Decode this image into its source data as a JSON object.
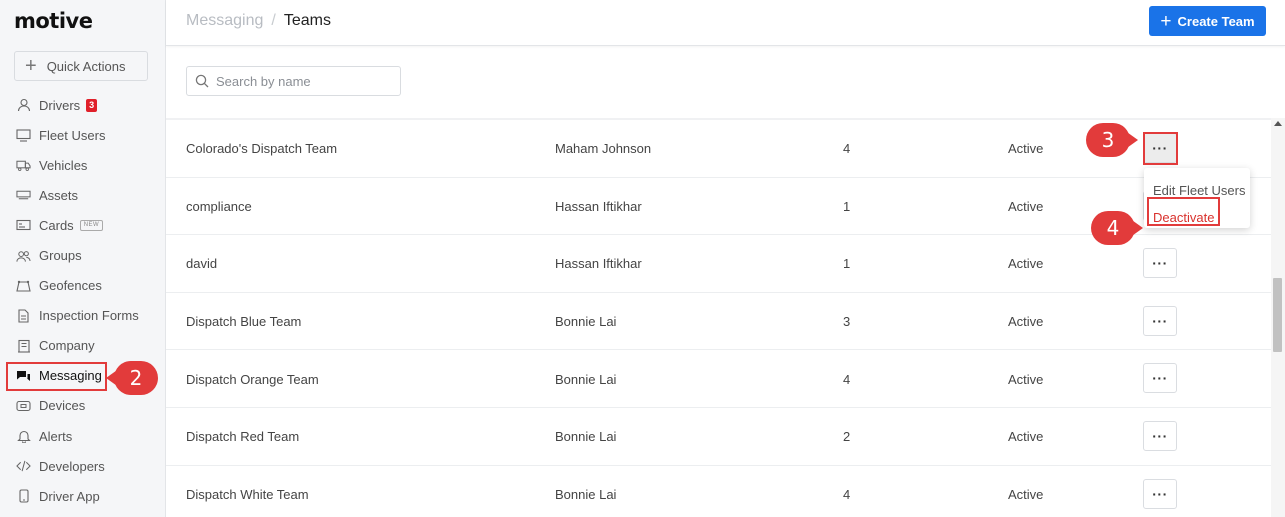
{
  "brand": {
    "logo": "motive"
  },
  "sidebar": {
    "quick_actions": "Quick Actions",
    "items": [
      {
        "label": "Drivers",
        "icon": "person-icon",
        "badge": "3"
      },
      {
        "label": "Fleet Users",
        "icon": "monitor-icon"
      },
      {
        "label": "Vehicles",
        "icon": "truck-icon"
      },
      {
        "label": "Assets",
        "icon": "trailer-icon"
      },
      {
        "label": "Cards",
        "icon": "card-icon",
        "tag": "NEW"
      },
      {
        "label": "Groups",
        "icon": "group-icon"
      },
      {
        "label": "Geofences",
        "icon": "geofence-icon"
      },
      {
        "label": "Inspection Forms",
        "icon": "document-icon"
      },
      {
        "label": "Company",
        "icon": "building-icon"
      },
      {
        "label": "Messaging",
        "icon": "chat-icon",
        "active": true
      },
      {
        "label": "Devices",
        "icon": "device-icon"
      },
      {
        "label": "Alerts",
        "icon": "bell-icon"
      },
      {
        "label": "Developers",
        "icon": "code-icon"
      },
      {
        "label": "Driver App",
        "icon": "phone-icon"
      }
    ]
  },
  "header": {
    "breadcrumb_parent": "Messaging",
    "breadcrumb_sep": "/",
    "breadcrumb_current": "Teams",
    "create_button": "Create Team"
  },
  "search": {
    "placeholder": "Search by name"
  },
  "teams": [
    {
      "name": "Colorado's Dispatch Team",
      "owner": "Maham Johnson",
      "count": "4",
      "status": "Active"
    },
    {
      "name": "compliance",
      "owner": "Hassan Iftikhar",
      "count": "1",
      "status": "Active"
    },
    {
      "name": "david",
      "owner": "Hassan Iftikhar",
      "count": "1",
      "status": "Active"
    },
    {
      "name": "Dispatch Blue Team",
      "owner": "Bonnie Lai",
      "count": "3",
      "status": "Active"
    },
    {
      "name": "Dispatch Orange Team",
      "owner": "Bonnie Lai",
      "count": "4",
      "status": "Active"
    },
    {
      "name": "Dispatch Red Team",
      "owner": "Bonnie Lai",
      "count": "2",
      "status": "Active"
    },
    {
      "name": "Dispatch White Team",
      "owner": "Bonnie Lai",
      "count": "4",
      "status": "Active"
    }
  ],
  "more_label": "···",
  "row_menu": {
    "edit": "Edit Fleet Users",
    "deactivate": "Deactivate"
  },
  "callouts": {
    "step2": "2",
    "step3": "3",
    "step4": "4"
  },
  "colors": {
    "accent": "#1a73e8",
    "annotation": "#e23b3b",
    "danger": "#d9312d"
  }
}
